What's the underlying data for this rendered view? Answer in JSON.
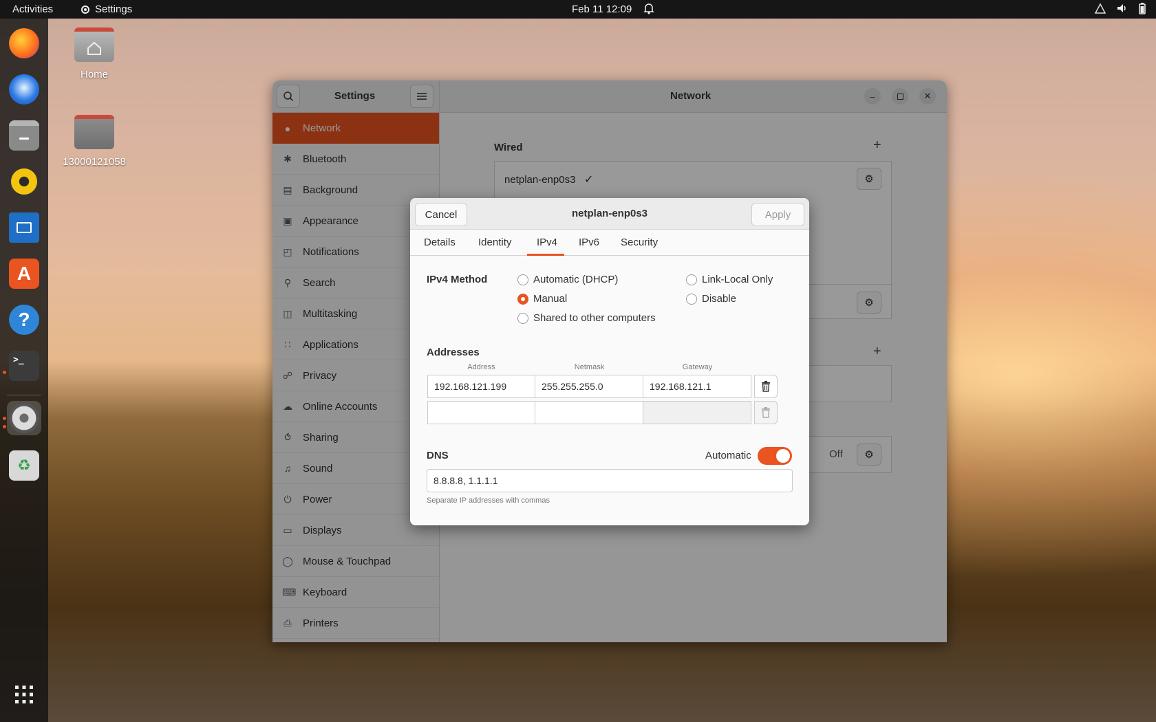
{
  "topbar": {
    "activities": "Activities",
    "app_name": "Settings",
    "datetime": "Feb 11  12:09"
  },
  "desktop": {
    "icons": [
      {
        "label": "Home"
      },
      {
        "label": "13000121058"
      }
    ]
  },
  "dock": {
    "items": [
      "firefox-icon",
      "thunderbird-icon",
      "files-icon",
      "rhythmbox-icon",
      "writer-icon",
      "app-center-icon",
      "help-icon",
      "terminal-icon",
      "settings-icon",
      "trash-icon"
    ],
    "show_apps_icon": "grid-icon"
  },
  "settings": {
    "sidebar_title": "Settings",
    "page_title": "Network",
    "sidebar_items": [
      {
        "label": "Network",
        "icon": "network-icon"
      },
      {
        "label": "Bluetooth",
        "icon": "bluetooth-icon"
      },
      {
        "label": "Background",
        "icon": "background-icon"
      },
      {
        "label": "Appearance",
        "icon": "appearance-icon"
      },
      {
        "label": "Notifications",
        "icon": "bell-icon"
      },
      {
        "label": "Search",
        "icon": "search-icon"
      },
      {
        "label": "Multitasking",
        "icon": "multitasking-icon"
      },
      {
        "label": "Applications",
        "icon": "applications-icon"
      },
      {
        "label": "Privacy",
        "icon": "lock-icon"
      },
      {
        "label": "Online Accounts",
        "icon": "cloud-icon"
      },
      {
        "label": "Sharing",
        "icon": "share-icon"
      },
      {
        "label": "Sound",
        "icon": "music-note-icon"
      },
      {
        "label": "Power",
        "icon": "power-icon"
      },
      {
        "label": "Displays",
        "icon": "display-icon"
      },
      {
        "label": "Mouse & Touchpad",
        "icon": "mouse-icon"
      },
      {
        "label": "Keyboard",
        "icon": "keyboard-icon"
      },
      {
        "label": "Printers",
        "icon": "printer-icon"
      }
    ],
    "wired": {
      "title": "Wired",
      "connection_name": "netplan-enp0s3"
    },
    "proxy_status": "Off"
  },
  "dialog": {
    "title": "netplan-enp0s3",
    "cancel_label": "Cancel",
    "apply_label": "Apply",
    "tabs": [
      "Details",
      "Identity",
      "IPv4",
      "IPv6",
      "Security"
    ],
    "active_tab": "IPv4",
    "ipv4_method_label": "IPv4 Method",
    "methods": {
      "auto": "Automatic (DHCP)",
      "manual": "Manual",
      "shared": "Shared to other computers",
      "link_local": "Link-Local Only",
      "disable": "Disable"
    },
    "selected_method": "Manual",
    "addresses_label": "Addresses",
    "columns": [
      "Address",
      "Netmask",
      "Gateway"
    ],
    "rows": [
      {
        "address": "192.168.121.199",
        "netmask": "255.255.255.0",
        "gateway": "192.168.121.1"
      },
      {
        "address": "",
        "netmask": "",
        "gateway": ""
      }
    ],
    "dns_label": "DNS",
    "dns_automatic_label": "Automatic",
    "dns_automatic": true,
    "dns_value": "8.8.8.8, 1.1.1.1",
    "dns_hint": "Separate IP addresses with commas"
  },
  "colors": {
    "accent": "#e95420",
    "topbar": "#161616"
  }
}
